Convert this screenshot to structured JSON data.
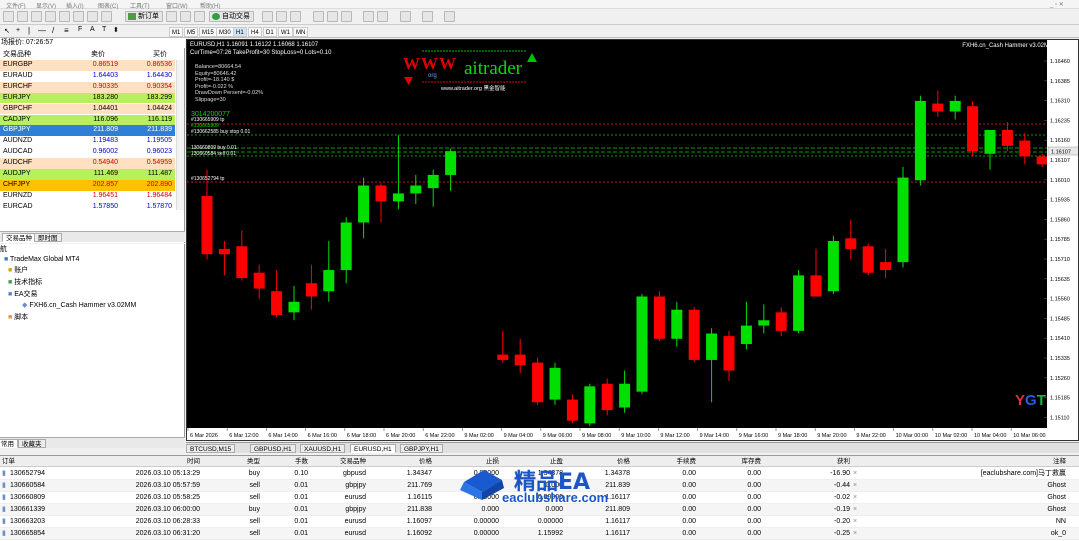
{
  "menu": [
    "文件(F)",
    "显示(V)",
    "插入(I)",
    "图表(C)",
    "工具(T)",
    "窗口(W)",
    "帮助(H)"
  ],
  "toolbar": {
    "new_order": "新订单",
    "auto_trade": "自动交易"
  },
  "timeframes": [
    "M1",
    "M5",
    "M15",
    "M30",
    "H1",
    "H4",
    "D1",
    "W1",
    "MN"
  ],
  "market_watch": {
    "title": "场报价: 07:26:57",
    "col_symbol": "交易品种",
    "col_bid": "卖价",
    "col_ask": "买价",
    "rows": [
      {
        "symbol": "EURGBP",
        "bid": "0.86519",
        "ask": "0.86536",
        "bg": "#ffe0c0",
        "bidc": "#d00000",
        "askc": "#d00000"
      },
      {
        "symbol": "EURAUD",
        "bid": "1.64403",
        "ask": "1.64430",
        "bg": "#ffffff",
        "bidc": "#0000c8",
        "askc": "#0000c8"
      },
      {
        "symbol": "EURCHF",
        "bid": "0.90335",
        "ask": "0.90354",
        "bg": "#ffe0c0",
        "bidc": "#d00000",
        "askc": "#d00000"
      },
      {
        "symbol": "EURJPY",
        "bid": "183.280",
        "ask": "183.299",
        "bg": "#b7f05a",
        "bidc": "#000000",
        "askc": "#000000"
      },
      {
        "symbol": "GBPCHF",
        "bid": "1.04401",
        "ask": "1.04424",
        "bg": "#ffe0c0",
        "bidc": "#000000",
        "askc": "#000000"
      },
      {
        "symbol": "CADJPY",
        "bid": "116.096",
        "ask": "116.119",
        "bg": "#b7f05a",
        "bidc": "#000000",
        "askc": "#000000"
      },
      {
        "symbol": "GBPJPY",
        "bid": "211.809",
        "ask": "211.839",
        "bg": "#2f7ed8",
        "bidc": "#ffffff",
        "askc": "#ffffff",
        "sel": true
      },
      {
        "symbol": "AUDNZD",
        "bid": "1.19483",
        "ask": "1.19505",
        "bg": "#ffffff",
        "bidc": "#0000c8",
        "askc": "#0000c8"
      },
      {
        "symbol": "AUDCAD",
        "bid": "0.96002",
        "ask": "0.96023",
        "bg": "#ffffff",
        "bidc": "#0000c8",
        "askc": "#0000c8"
      },
      {
        "symbol": "AUDCHF",
        "bid": "0.54940",
        "ask": "0.54959",
        "bg": "#ffe0c0",
        "bidc": "#d00000",
        "askc": "#d00000"
      },
      {
        "symbol": "AUDJPY",
        "bid": "111.469",
        "ask": "111.487",
        "bg": "#b7f05a",
        "bidc": "#000000",
        "askc": "#000000"
      },
      {
        "symbol": "CHFJPY",
        "bid": "202.857",
        "ask": "202.890",
        "bg": "#ffc000",
        "bidc": "#d00000",
        "askc": "#d00000"
      },
      {
        "symbol": "EURNZD",
        "bid": "1.96451",
        "ask": "1.96484",
        "bg": "#ffffff",
        "bidc": "#d00000",
        "askc": "#d00000"
      },
      {
        "symbol": "EURCAD",
        "bid": "1.57850",
        "ask": "1.57870",
        "bg": "#ffffff",
        "bidc": "#0000c8",
        "askc": "#0000c8"
      }
    ],
    "tabs": [
      "交易品种",
      "即时图"
    ]
  },
  "navigator": {
    "title": "航",
    "items": [
      "TradeMax Global MT4",
      "账户",
      "技术指标",
      "EA交易",
      "FXH6.cn_Cash Hammer v3.02MM",
      "脚本"
    ],
    "tabs": [
      "常用",
      "收藏夹"
    ]
  },
  "chart": {
    "symbol_line": "EURUSD,H1  1.16091 1.16122 1.16068 1.16107",
    "curtime_line": "CurTime=07:26  TakeProfit=30  StopLoss=0  Lots=0.10",
    "info": [
      "Balance=80664.54",
      "Equity=80646.42",
      "Profit=-18.140 $",
      "Profit=-0.022 %",
      "DrawDown Persent=-0.02%",
      "Slippage=30"
    ],
    "ea_name": "FXH6.cn_Cash Hammer v3.02MM",
    "logo_www": "WWW",
    "logo_org": "org",
    "logo_brand": "aitrader",
    "logo_sub": "www.aitrader.org 黑金智能",
    "order_labels": [
      "3014200077",
      "#130665909 tp",
      "#130665909",
      "#130662585 buy stop 0.01",
      "130660809 buy 0.01",
      "130660584 sell 0.01",
      "#130652794 tp"
    ],
    "price_labels": [
      "1.16460",
      "1.16385",
      "1.16310",
      "1.16235",
      "1.16160",
      "1.16107",
      "1.16010",
      "1.15935",
      "1.15860",
      "1.15785",
      "1.15710",
      "1.15635",
      "1.15560",
      "1.15485",
      "1.15410",
      "1.15335",
      "1.15260",
      "1.15185",
      "1.15110"
    ],
    "time_labels": [
      "6 Mar 2026",
      "6 Mar 12:00",
      "6 Mar 14:00",
      "6 Mar 16:00",
      "6 Mar 18:00",
      "6 Mar 20:00",
      "6 Mar 22:00",
      "9 Mar 02:00",
      "9 Mar 04:00",
      "9 Mar 06:00",
      "9 Mar 08:00",
      "9 Mar 10:00",
      "9 Mar 12:00",
      "9 Mar 14:00",
      "9 Mar 16:00",
      "9 Mar 18:00",
      "9 Mar 20:00",
      "9 Mar 22:00",
      "10 Mar 00:00",
      "10 Mar 02:00",
      "10 Mar 04:00",
      "10 Mar 06:00"
    ],
    "corner_badge": "YGT",
    "colors": {
      "bull": "#00e000",
      "bear": "#ff0000",
      "bg": "#000000"
    }
  },
  "chart_tabs": [
    "BTCUSD,M15",
    "GBPUSD,H1",
    "XAUUSD,H1",
    "EURUSD,H1",
    "GBPJPY,H1"
  ],
  "terminal": {
    "headers": [
      "订单",
      "时间",
      "类型",
      "手数",
      "交易品种",
      "价格",
      "止损",
      "止盈",
      "价格",
      "手续费",
      "库存费",
      "获利",
      "注释"
    ],
    "rows": [
      {
        "ticket": "130652794",
        "time": "2026.03.10 05:13:29",
        "type": "buy",
        "lots": "0.10",
        "symbol": "gbpusd",
        "price": "1.34347",
        "sl": "0.00000",
        "tp": "1.34378",
        "cur": "1.34378",
        "comm": "0.00",
        "swap": "0.00",
        "profit": "-16.90",
        "comment": "[eaclubshare.com]马丁救赢"
      },
      {
        "ticket": "130660584",
        "time": "2026.03.10 05:57:59",
        "type": "sell",
        "lots": "0.01",
        "symbol": "gbpjpy",
        "price": "211.769",
        "sl": "0.000",
        "tp": "0.000",
        "cur": "211.839",
        "comm": "0.00",
        "swap": "0.00",
        "profit": "-0.44",
        "comment": "Ghost"
      },
      {
        "ticket": "130660809",
        "time": "2026.03.10 05:58:25",
        "type": "sell",
        "lots": "0.01",
        "symbol": "eurusd",
        "price": "1.16115",
        "sl": "0.00000",
        "tp": "0.00000",
        "cur": "1.16117",
        "comm": "0.00",
        "swap": "0.00",
        "profit": "-0.02",
        "comment": "Ghost"
      },
      {
        "ticket": "130661339",
        "time": "2026.03.10 06:00:00",
        "type": "buy",
        "lots": "0.01",
        "symbol": "gbpjpy",
        "price": "211.838",
        "sl": "0.000",
        "tp": "0.000",
        "cur": "211.809",
        "comm": "0.00",
        "swap": "0.00",
        "profit": "-0.19",
        "comment": "Ghost"
      },
      {
        "ticket": "130663203",
        "time": "2026.03.10 06:28:33",
        "type": "sell",
        "lots": "0.01",
        "symbol": "eurusd",
        "price": "1.16097",
        "sl": "0.00000",
        "tp": "0.00000",
        "cur": "1.16117",
        "comm": "0.00",
        "swap": "0.00",
        "profit": "-0.20",
        "comment": "NN"
      },
      {
        "ticket": "130665854",
        "time": "2026.03.10 06:31:20",
        "type": "sell",
        "lots": "0.01",
        "symbol": "eurusd",
        "price": "1.16092",
        "sl": "0.00000",
        "tp": "1.15992",
        "cur": "1.16117",
        "comm": "0.00",
        "swap": "0.00",
        "profit": "-0.25",
        "comment": "ok_0"
      }
    ]
  },
  "watermark": {
    "title": "精品EA",
    "url": "eaclubshare.com"
  }
}
